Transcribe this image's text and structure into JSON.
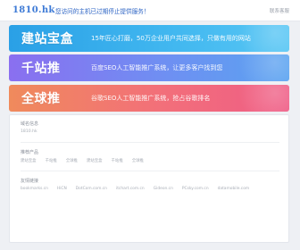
{
  "header": {
    "domain": "1810.hk",
    "notice": "您访问的主机已过期停止提供服务！",
    "contact": "联系客服"
  },
  "banners": [
    {
      "name": "建站宝盒",
      "desc": "15年匠心打磨，50万企业用户共同选择，只做有用的网站",
      "color": "#2aa0e6"
    },
    {
      "name": "千站推",
      "desc": "百度SEO人工智能推广系统，让更多客户找到您",
      "color": "#7f7cf0"
    },
    {
      "name": "全球推",
      "desc": "谷歌SEO人工智能推广系统，抢占谷歌排名",
      "color": "#f2757a"
    }
  ],
  "panel": {
    "section1": {
      "label": "域名信息",
      "value": "1810.hk"
    },
    "section2": {
      "label": "推荐产品",
      "items": [
        "建站宝盒",
        "千站推",
        "全球推",
        "建站宝盒",
        "千站推",
        "全球推"
      ]
    },
    "section3": {
      "label": "友情链接",
      "items": [
        "bookmarks.cn",
        "HiCN",
        "DotCom.com.cn",
        "itchart.com.cn",
        "Gideon.cn",
        "PCsky.com.cn",
        "datamobile.com"
      ]
    }
  }
}
